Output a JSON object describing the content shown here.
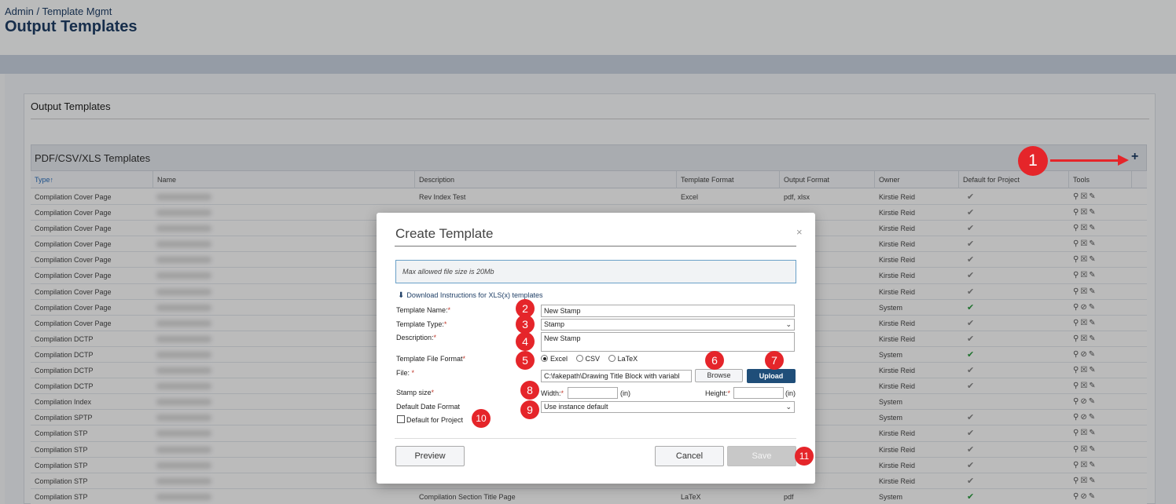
{
  "header": {
    "breadcrumb": "Admin / Template Mgmt",
    "title": "Output Templates"
  },
  "panel": {
    "title": "Output Templates",
    "grid_title": "PDF/CSV/XLS Templates",
    "add_icon": "+"
  },
  "columns": [
    {
      "label": "Type",
      "sort": "↑"
    },
    {
      "label": "Name"
    },
    {
      "label": "Description"
    },
    {
      "label": "Template Format"
    },
    {
      "label": "Output Format"
    },
    {
      "label": "Owner"
    },
    {
      "label": "Default for Project"
    },
    {
      "label": "Tools"
    }
  ],
  "rows": [
    {
      "type": "Compilation Cover Page",
      "desc": "Rev Index Test",
      "tfmt": "Excel",
      "ofmt": "pdf, xlsx",
      "owner": "Kirstie Reid",
      "def": "✔",
      "tools": "⚲☒✎"
    },
    {
      "type": "Compilation Cover Page",
      "desc": "",
      "tfmt": "",
      "ofmt": "",
      "owner": "Kirstie Reid",
      "def": "✔",
      "tools": "⚲☒✎"
    },
    {
      "type": "Compilation Cover Page",
      "desc": "",
      "tfmt": "",
      "ofmt": "",
      "owner": "Kirstie Reid",
      "def": "✔",
      "tools": "⚲☒✎"
    },
    {
      "type": "Compilation Cover Page",
      "desc": "",
      "tfmt": "",
      "ofmt": "",
      "owner": "Kirstie Reid",
      "def": "✔",
      "tools": "⚲☒✎"
    },
    {
      "type": "Compilation Cover Page",
      "desc": "",
      "tfmt": "",
      "ofmt": "",
      "owner": "Kirstie Reid",
      "def": "✔",
      "tools": "⚲☒✎"
    },
    {
      "type": "Compilation Cover Page",
      "desc": "",
      "tfmt": "",
      "ofmt": "",
      "owner": "Kirstie Reid",
      "def": "✔",
      "tools": "⚲☒✎"
    },
    {
      "type": "Compilation Cover Page",
      "desc": "",
      "tfmt": "",
      "ofmt": "",
      "owner": "Kirstie Reid",
      "def": "✔",
      "tools": "⚲☒✎"
    },
    {
      "type": "Compilation Cover Page",
      "desc": "",
      "tfmt": "",
      "ofmt": "",
      "owner": "System",
      "def": "✔",
      "green": true,
      "tools": "⚲⊘✎"
    },
    {
      "type": "Compilation Cover Page",
      "desc": "",
      "tfmt": "",
      "ofmt": "",
      "owner": "Kirstie Reid",
      "def": "✔",
      "tools": "⚲☒✎"
    },
    {
      "type": "Compilation DCTP",
      "desc": "",
      "tfmt": "",
      "ofmt": "",
      "owner": "Kirstie Reid",
      "def": "✔",
      "tools": "⚲☒✎"
    },
    {
      "type": "Compilation DCTP",
      "desc": "",
      "tfmt": "",
      "ofmt": "",
      "owner": "System",
      "def": "✔",
      "green": true,
      "tools": "⚲⊘✎"
    },
    {
      "type": "Compilation DCTP",
      "desc": "",
      "tfmt": "",
      "ofmt": "",
      "owner": "Kirstie Reid",
      "def": "✔",
      "tools": "⚲☒✎"
    },
    {
      "type": "Compilation DCTP",
      "desc": "",
      "tfmt": "",
      "ofmt": "",
      "owner": "Kirstie Reid",
      "def": "✔",
      "tools": "⚲☒✎"
    },
    {
      "type": "Compilation Index",
      "desc": "",
      "tfmt": "",
      "ofmt": "",
      "owner": "System",
      "def": "",
      "tools": "⚲⊘✎"
    },
    {
      "type": "Compilation SPTP",
      "desc": "",
      "tfmt": "",
      "ofmt": "",
      "owner": "System",
      "def": "✔",
      "tools": "⚲⊘✎"
    },
    {
      "type": "Compilation STP",
      "desc": "",
      "tfmt": "",
      "ofmt": "",
      "owner": "Kirstie Reid",
      "def": "✔",
      "tools": "⚲☒✎"
    },
    {
      "type": "Compilation STP",
      "desc": "",
      "tfmt": "",
      "ofmt": "",
      "owner": "Kirstie Reid",
      "def": "✔",
      "tools": "⚲☒✎"
    },
    {
      "type": "Compilation STP",
      "desc": "",
      "tfmt": "",
      "ofmt": "",
      "owner": "Kirstie Reid",
      "def": "✔",
      "tools": "⚲☒✎"
    },
    {
      "type": "Compilation STP",
      "desc": "",
      "tfmt": "",
      "ofmt": "",
      "owner": "Kirstie Reid",
      "def": "✔",
      "tools": "⚲☒✎"
    },
    {
      "type": "Compilation STP",
      "desc": "Compilation Section Title Page",
      "tfmt": "LaTeX",
      "ofmt": "pdf",
      "owner": "System",
      "def": "✔",
      "green": true,
      "tools": "⚲⊘✎"
    }
  ],
  "modal": {
    "title": "Create Template",
    "close": "×",
    "info": "Max allowed file size is 20Mb",
    "download_link": "Download Instructions for XLS(x) templates",
    "labels": {
      "template_name": "Template Name:",
      "template_type": "Template Type:",
      "description": "Description:",
      "file_format": "Template File Format",
      "file": "File: ",
      "stamp_size": "Stamp size",
      "default_date_format": "Default Date Format",
      "width": "Width:",
      "height": "Height:",
      "unit": "(in)",
      "required": "*"
    },
    "values": {
      "template_name": "New Stamp",
      "template_type": "Stamp",
      "description": "New Stamp",
      "file_path": "C:\\fakepath\\Drawing Title Block with variabl",
      "date_format": "Use instance default",
      "width": "",
      "height": ""
    },
    "formats": [
      "Excel",
      "CSV",
      "LaTeX"
    ],
    "selected_format": "Excel",
    "default_for_project": "Default for Project",
    "buttons": {
      "browse": "Browse",
      "upload": "Upload",
      "preview": "Preview",
      "cancel": "Cancel",
      "save": "Save"
    }
  },
  "annotations": [
    "1",
    "2",
    "3",
    "4",
    "5",
    "6",
    "7",
    "8",
    "9",
    "10",
    "11"
  ],
  "colors": {
    "annotation": "#e5252a",
    "primary": "#1f4e79",
    "link": "#1f3f66"
  }
}
